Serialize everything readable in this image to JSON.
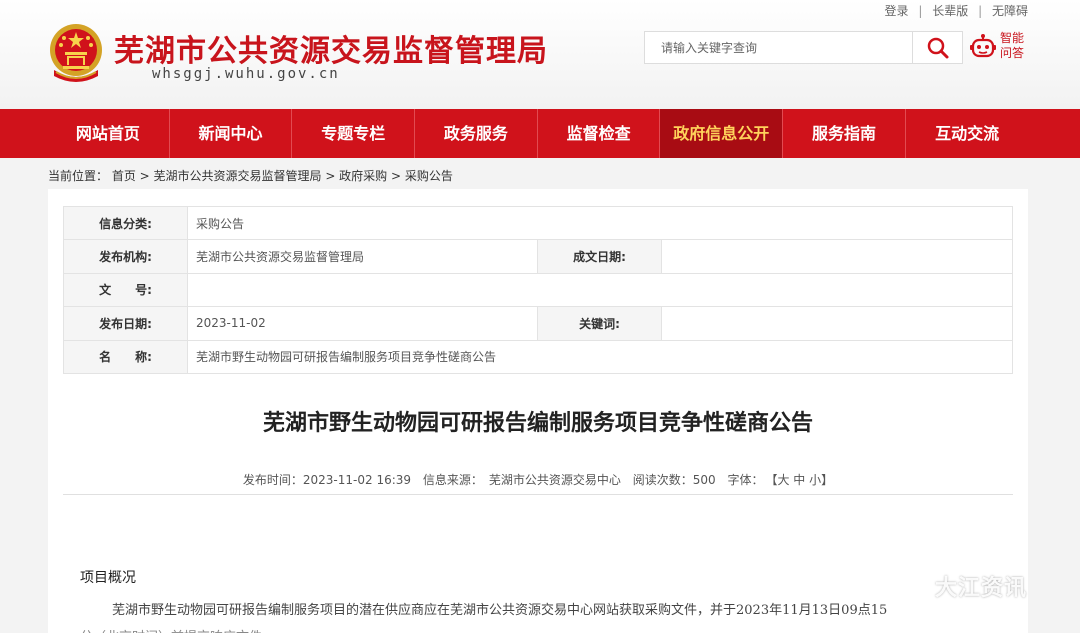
{
  "header": {
    "top_links": [
      "登录",
      "长辈版",
      "无障碍"
    ],
    "top_sep": "|",
    "title": "芜湖市公共资源交易监督管理局",
    "domain": "whsggj.wuhu.gov.cn",
    "search_placeholder": "请输入关键字查询",
    "smart_qa": "智能问答"
  },
  "nav": {
    "items": [
      "网站首页",
      "新闻中心",
      "专题专栏",
      "政务服务",
      "监督检查",
      "政府信息公开",
      "服务指南",
      "互动交流"
    ],
    "active_index": 5
  },
  "breadcrumb": "当前位置： 首页 > 芜湖市公共资源交易监督管理局 > 政府采购 > 采购公告",
  "info_table": {
    "category_label": "信息分类:",
    "category_value": "采购公告",
    "publisher_label": "发布机构:",
    "publisher_value": "芜湖市公共资源交易监督管理局",
    "date_written_label": "成文日期:",
    "date_written_value": "",
    "doc_no_label": "文　　号:",
    "doc_no_value": "",
    "publish_date_label": "发布日期:",
    "publish_date_value": "2023-11-02",
    "keywords_label": "关键词:",
    "keywords_value": "",
    "name_label": "名　　称:",
    "name_value": "芜湖市野生动物园可研报告编制服务项目竞争性磋商公告"
  },
  "article": {
    "title": "芜湖市野生动物园可研报告编制服务项目竞争性磋商公告",
    "meta_time": "发布时间：2023-11-02 16:39",
    "meta_source": "信息来源：　芜湖市公共资源交易中心",
    "meta_views": "阅读次数：500",
    "meta_font_label": "字体：",
    "meta_font_sizes": "【大 中 小】",
    "section_title": "项目概况",
    "paragraph": "芜湖市野生动物园可研报告编制服务项目的潜在供应商应在芜湖市公共资源交易中心网站获取采购文件，并于2023年11月13日09点15",
    "paragraph_cont": "分（北京时间）前提交响应文件。"
  },
  "watermark": "大江资讯",
  "colors": {
    "brand_red": "#d0121b",
    "nav_active_bg": "#a80c13",
    "nav_active_text": "#ffd35c",
    "title_red": "#c8141c"
  },
  "icons": {
    "emblem": "national-emblem-icon",
    "search": "search-icon",
    "robot": "robot-icon",
    "watermark": "wechat-icon"
  }
}
